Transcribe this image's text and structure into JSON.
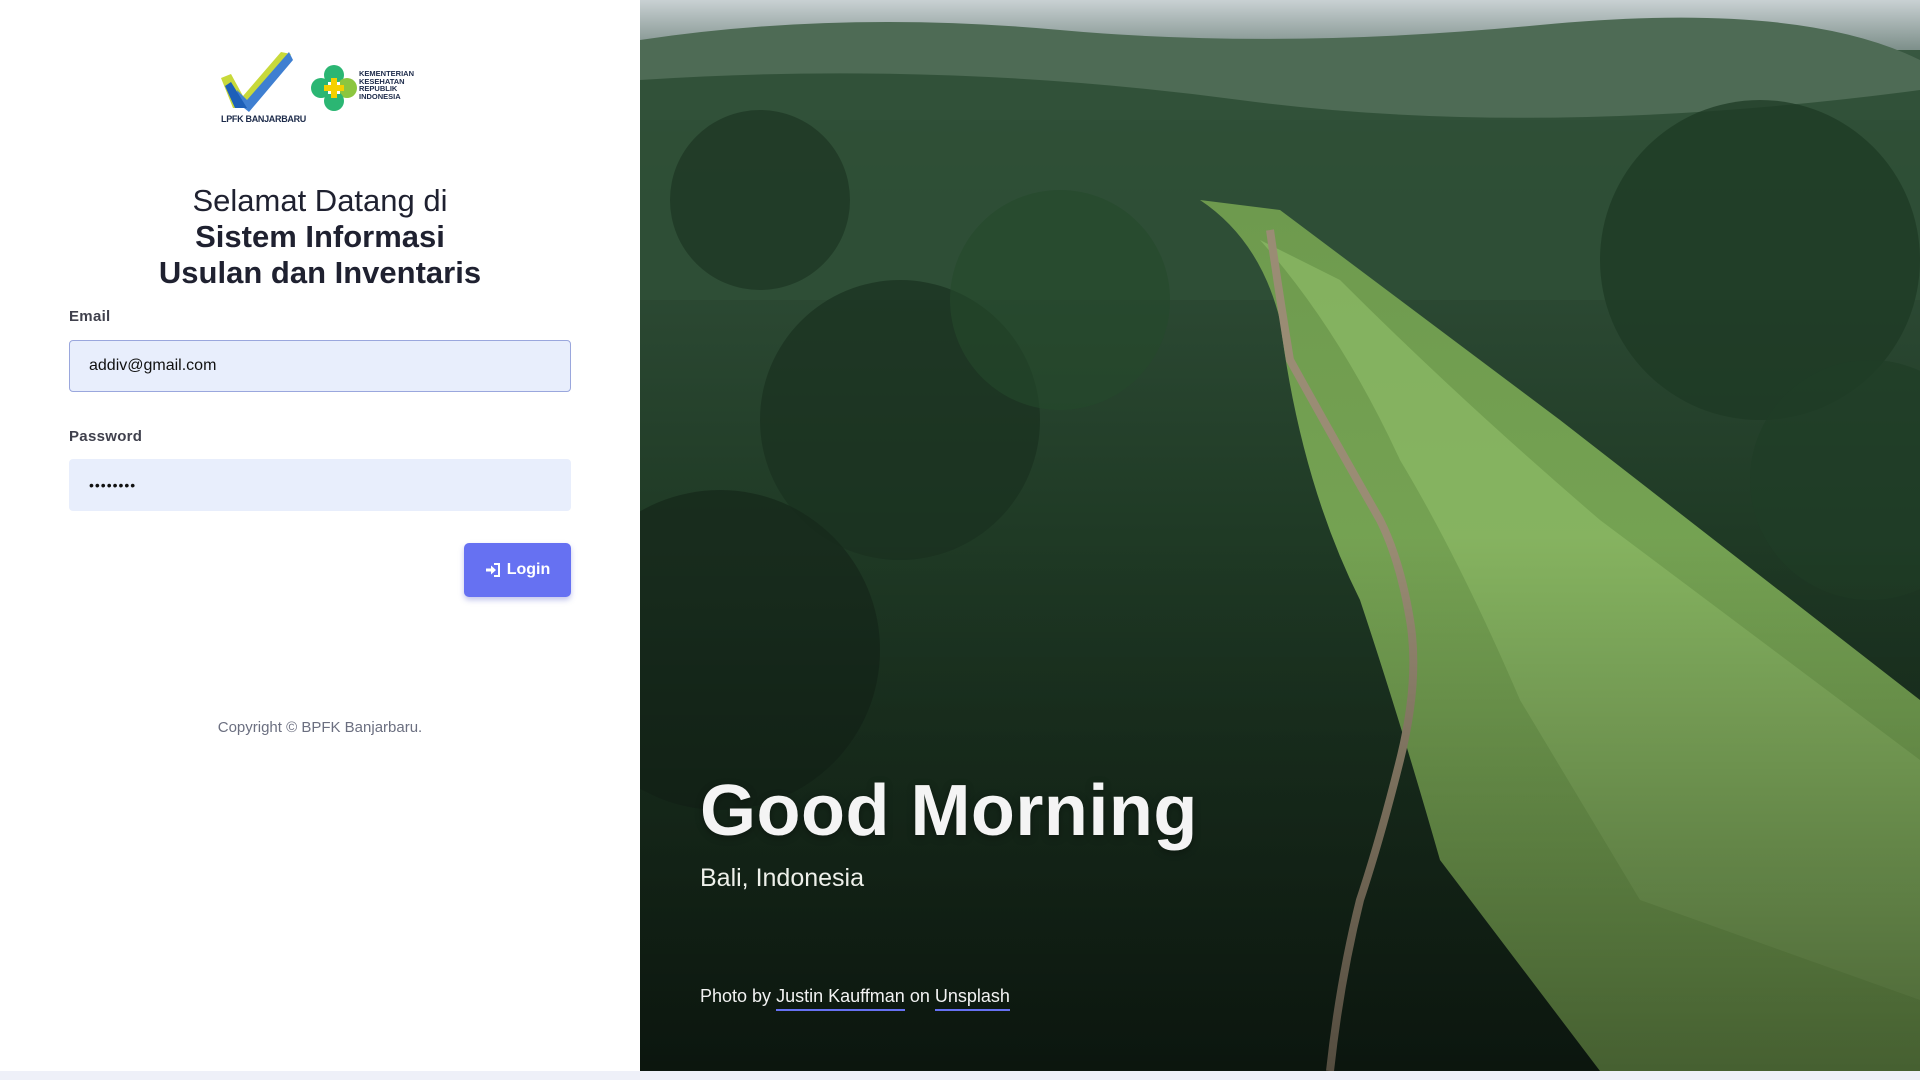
{
  "logos": {
    "lpfk_text": "LPFK BANJARBARU",
    "kemenkes_line1": "KEMENTERIAN",
    "kemenkes_line2": "KESEHATAN",
    "kemenkes_line3": "REPUBLIK",
    "kemenkes_line4": "INDONESIA"
  },
  "welcome": {
    "line1": "Selamat Datang di",
    "line2": "Sistem Informasi",
    "line3": "Usulan dan Inventaris"
  },
  "form": {
    "email_label": "Email",
    "email_value": "addiv@gmail.com",
    "password_label": "Password",
    "password_value": "••••••••",
    "login_label": "Login"
  },
  "footer": {
    "copyright": "Copyright © BPFK Banjarbaru."
  },
  "hero": {
    "greeting": "Good Morning",
    "location": "Bali, Indonesia",
    "credit_prefix": "Photo by ",
    "credit_author": "Justin Kauffman",
    "credit_mid": " on ",
    "credit_site": "Unsplash"
  },
  "colors": {
    "accent": "#6671f2",
    "input_bg": "#e8eefc"
  },
  "icons": {
    "login": "sign-in-icon"
  }
}
